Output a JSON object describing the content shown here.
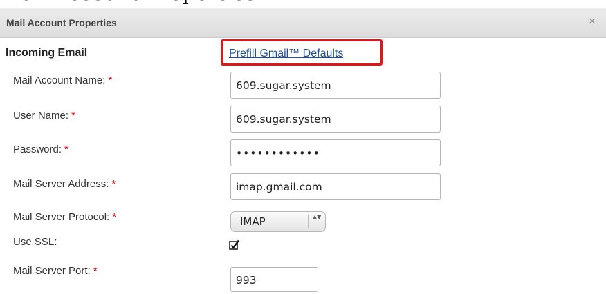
{
  "cut_heading": "Mail Account Properties",
  "dialog": {
    "title": "Mail Account Properties",
    "close_glyph": "×",
    "close_icon": "close-icon"
  },
  "section": {
    "title": "Incoming Email",
    "prefill_link": "Prefill Gmail™ Defaults",
    "highlight_color": "#e0161b"
  },
  "required_marker": "*",
  "fields": {
    "account_name": {
      "label": "Mail Account Name:",
      "value": "609.sugar.system"
    },
    "user_name": {
      "label": "User Name:",
      "value": "609.sugar.system"
    },
    "password": {
      "label": "Password:",
      "value": "••••••••••••"
    },
    "server_address": {
      "label": "Mail Server Address:",
      "value": "imap.gmail.com"
    },
    "protocol": {
      "label": "Mail Server Protocol:",
      "value": "IMAP",
      "arrows": "▲▼"
    },
    "use_ssl": {
      "label": "Use SSL:",
      "checked": true
    },
    "port": {
      "label": "Mail Server Port:",
      "value": "993"
    }
  }
}
